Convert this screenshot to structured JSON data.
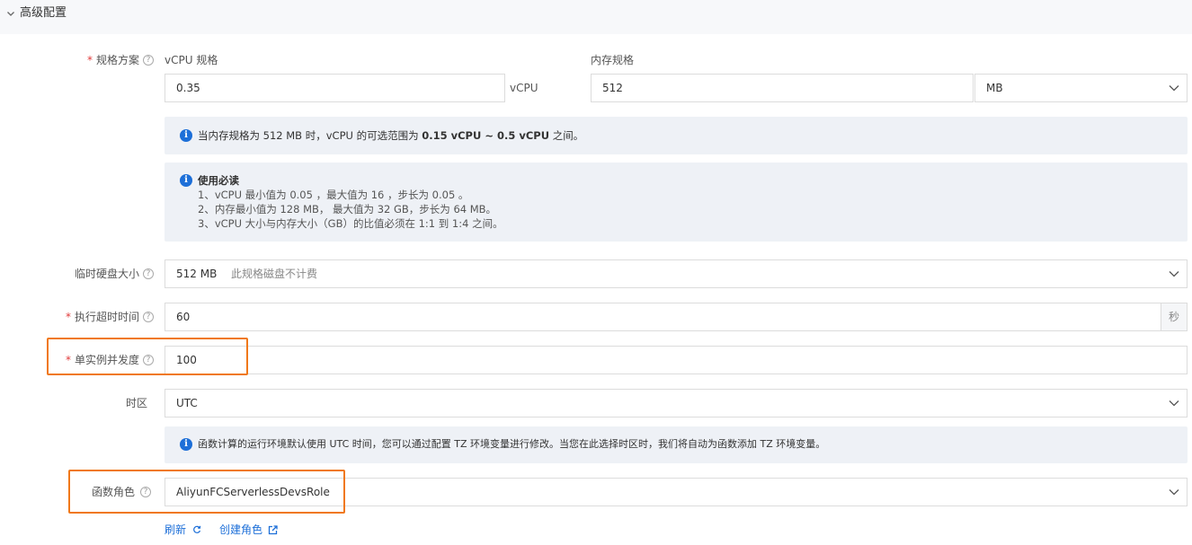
{
  "section": {
    "title": "高级配置"
  },
  "spec": {
    "label": "规格方案",
    "vcpu_label": "vCPU 规格",
    "vcpu_value": "0.35",
    "vcpu_unit": "vCPU",
    "memory_label": "内存规格",
    "memory_value": "512",
    "memory_unit": "MB",
    "range_notice": {
      "prefix": "当内存规格为 512 MB 时，vCPU 的可选范围为 ",
      "range": "0.15 vCPU ~ 0.5 vCPU",
      "suffix": " 之间。"
    },
    "readme": {
      "title": "使用必读",
      "lines": [
        "1、vCPU 最小值为 0.05 ，最大值为 16 ，步长为 0.05 。",
        "2、内存最小值为 128 MB， 最大值为 32 GB，步长为 64 MB。",
        "3、vCPU 大小与内存大小（GB）的比值必须在 1:1 到 1:4 之间。"
      ]
    }
  },
  "disk": {
    "label": "临时硬盘大小",
    "value": "512 MB",
    "hint": "此规格磁盘不计费"
  },
  "timeout": {
    "label": "执行超时时间",
    "value": "60",
    "unit": "秒"
  },
  "concurrency": {
    "label": "单实例并发度",
    "value": "100"
  },
  "timezone": {
    "label": "时区",
    "value": "UTC",
    "notice": "函数计算的运行环境默认使用 UTC 时间，您可以通过配置 TZ 环境变量进行修改。当您在此选择时区时，我们将自动为函数添加 TZ 环境变量。"
  },
  "role": {
    "label": "函数角色",
    "value": "AliyunFCServerlessDevsRole",
    "refresh_label": "刷新",
    "create_label": "创建角色"
  },
  "colors": {
    "required": "#e13a3a",
    "info_blue": "#1d6fd8",
    "highlight": "#f07818",
    "notice_bg": "#eef1f6"
  }
}
